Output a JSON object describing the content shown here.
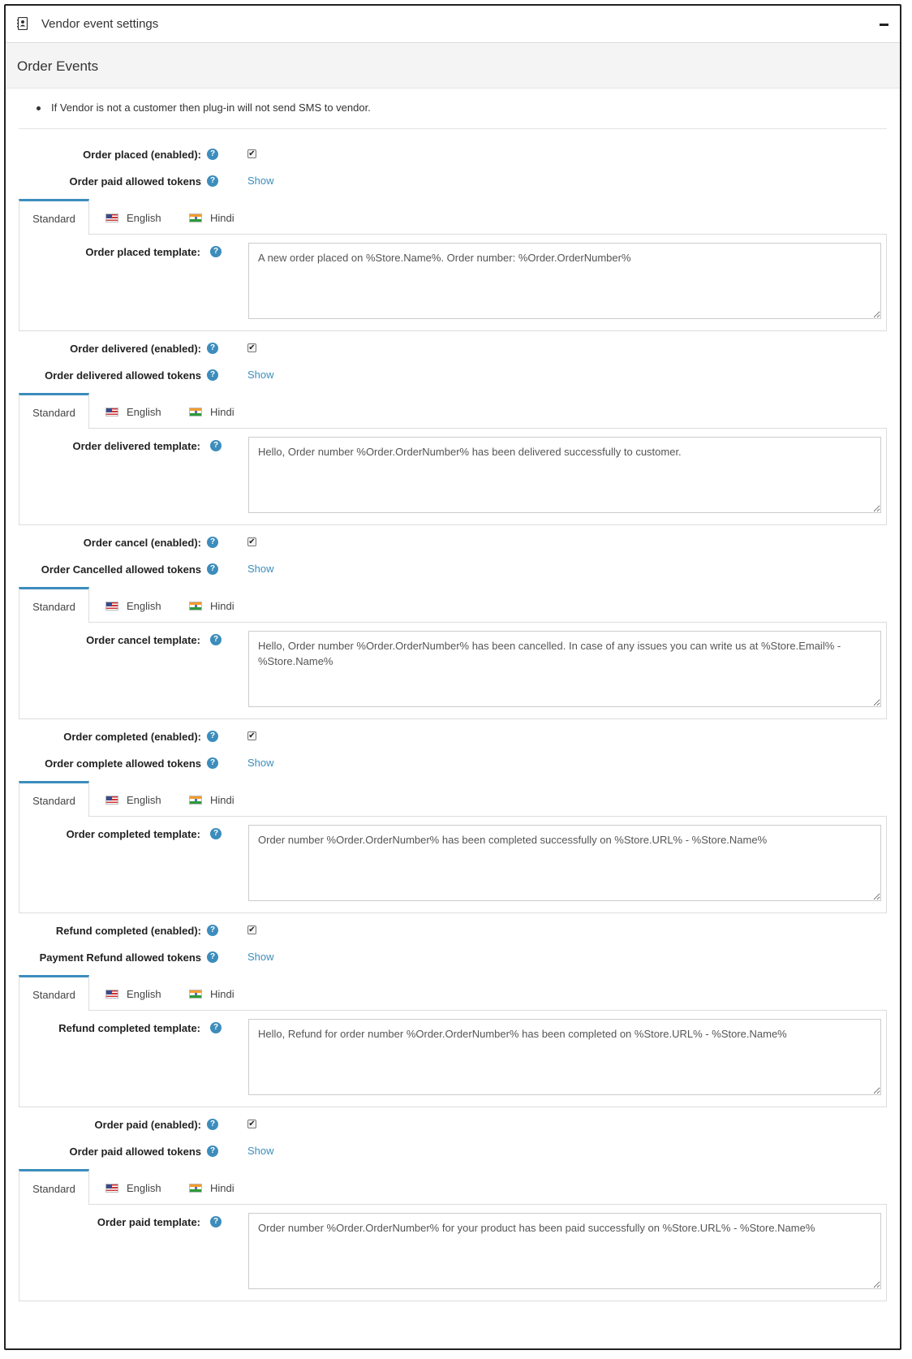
{
  "panel": {
    "title": "Vendor event settings",
    "icon": "contact-book-icon",
    "collapse_icon": "minus-icon"
  },
  "section": {
    "title": "Order Events",
    "note": "If Vendor is not a customer then plug-in will not send SMS to vendor."
  },
  "tabs": {
    "standard": "Standard",
    "english": "English",
    "hindi": "Hindi"
  },
  "help_glyph": "?",
  "check_glyph": "✔",
  "events": [
    {
      "enabled_label": "Order placed (enabled):",
      "enabled": true,
      "tokens_label": "Order paid allowed tokens",
      "tokens_link": "Show",
      "template_label": "Order placed template:",
      "template_value": "A new order placed on %Store.Name%. Order number: %Order.OrderNumber%"
    },
    {
      "enabled_label": "Order delivered (enabled):",
      "enabled": true,
      "tokens_label": "Order delivered allowed tokens",
      "tokens_link": "Show",
      "template_label": "Order delivered template:",
      "template_value": "Hello, Order number %Order.OrderNumber% has been delivered successfully to customer."
    },
    {
      "enabled_label": "Order cancel (enabled):",
      "enabled": true,
      "tokens_label": "Order Cancelled allowed tokens",
      "tokens_link": "Show",
      "template_label": "Order cancel template:",
      "template_value": "Hello, Order number %Order.OrderNumber% has been cancelled. In case of any issues you can write us at %Store.Email% - %Store.Name%"
    },
    {
      "enabled_label": "Order completed (enabled):",
      "enabled": true,
      "tokens_label": "Order complete allowed tokens",
      "tokens_link": "Show",
      "template_label": "Order completed template:",
      "template_value": "Order number %Order.OrderNumber% has been completed successfully on %Store.URL% - %Store.Name%"
    },
    {
      "enabled_label": "Refund completed (enabled):",
      "enabled": true,
      "tokens_label": "Payment Refund allowed tokens",
      "tokens_link": "Show",
      "template_label": "Refund completed template:",
      "template_value": "Hello, Refund for order number %Order.OrderNumber% has been completed on %Store.URL% - %Store.Name%"
    },
    {
      "enabled_label": "Order paid (enabled):",
      "enabled": true,
      "tokens_label": "Order paid allowed tokens",
      "tokens_link": "Show",
      "template_label": "Order paid template:",
      "template_value": "Order number %Order.OrderNumber% for your product has been paid successfully on %Store.URL% - %Store.Name%"
    }
  ]
}
